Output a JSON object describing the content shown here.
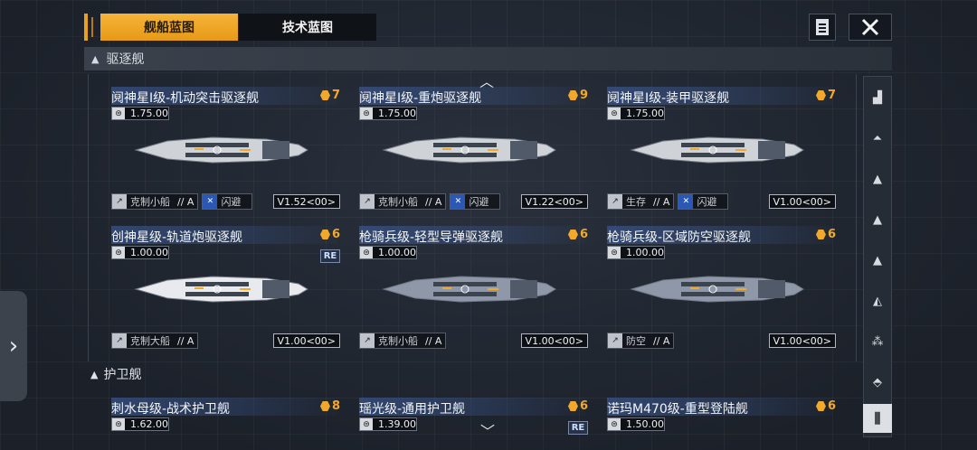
{
  "tabs": [
    {
      "label": "舰船蓝图",
      "active": true
    },
    {
      "label": "技术蓝图",
      "active": false
    }
  ],
  "icons": {
    "doc": "document-list-icon",
    "close": "close-icon"
  },
  "sections": {
    "destroyer": {
      "label": "驱逐舰"
    },
    "frigate": {
      "label": "护卫舰"
    }
  },
  "destroyers": [
    {
      "title": "阋神星I级-机动突击驱逐舰",
      "cost": "7",
      "speed": "1.75",
      "speed_unit": ".00",
      "tags": [
        {
          "label": "克制小船",
          "cls": "A"
        },
        {
          "label": "闪避",
          "cls": ""
        }
      ],
      "version": "V1.52<00>",
      "re": ""
    },
    {
      "title": "阋神星I级-重炮驱逐舰",
      "cost": "9",
      "speed": "1.75",
      "speed_unit": ".00",
      "tags": [
        {
          "label": "克制小船",
          "cls": "A"
        },
        {
          "label": "闪避",
          "cls": ""
        }
      ],
      "version": "V1.22<00>",
      "re": ""
    },
    {
      "title": "阋神星I级-装甲驱逐舰",
      "cost": "7",
      "speed": "1.75",
      "speed_unit": ".00",
      "tags": [
        {
          "label": "生存",
          "cls": "A"
        },
        {
          "label": "闪避",
          "cls": ""
        }
      ],
      "version": "V1.00<00>",
      "re": ""
    },
    {
      "title": "创神星级-轨道炮驱逐舰",
      "cost": "6",
      "speed": "1.00",
      "speed_unit": ".00",
      "tags": [
        {
          "label": "克制大船",
          "cls": "A"
        }
      ],
      "version": "V1.00<00>",
      "re": "RE"
    },
    {
      "title": "枪骑兵级-轻型导弹驱逐舰",
      "cost": "6",
      "speed": "1.00",
      "speed_unit": ".00",
      "tags": [
        {
          "label": "克制小船",
          "cls": "A"
        }
      ],
      "version": "V1.00<00>",
      "re": ""
    },
    {
      "title": "枪骑兵级-区域防空驱逐舰",
      "cost": "6",
      "speed": "1.00",
      "speed_unit": ".00",
      "tags": [
        {
          "label": "防空",
          "cls": "A"
        }
      ],
      "version": "V1.00<00>",
      "re": ""
    }
  ],
  "frigates": [
    {
      "title": "刺水母级-战术护卫舰",
      "cost": "8",
      "speed": "1.62",
      "speed_unit": ".00",
      "re": ""
    },
    {
      "title": "瑶光级-通用护卫舰",
      "cost": "6",
      "speed": "1.39",
      "speed_unit": ".00",
      "re": "RE"
    },
    {
      "title": "诺玛M470级-重型登陆舰",
      "cost": "6",
      "speed": "1.50",
      "speed_unit": ".00",
      "re": ""
    }
  ],
  "rail_icons": [
    "carrier-icon",
    "cruiser-icon",
    "destroyer-icon",
    "frigate-icon",
    "corvette-icon",
    "fighter-icon",
    "drone-icon",
    "support-icon"
  ],
  "filter_icon": "filter-icon",
  "pull_icon": "chevron-right-icon",
  "colors": {
    "accent": "#f2a82a",
    "tab_active": "#f0a823",
    "title_highlight": "#3c5a96"
  }
}
